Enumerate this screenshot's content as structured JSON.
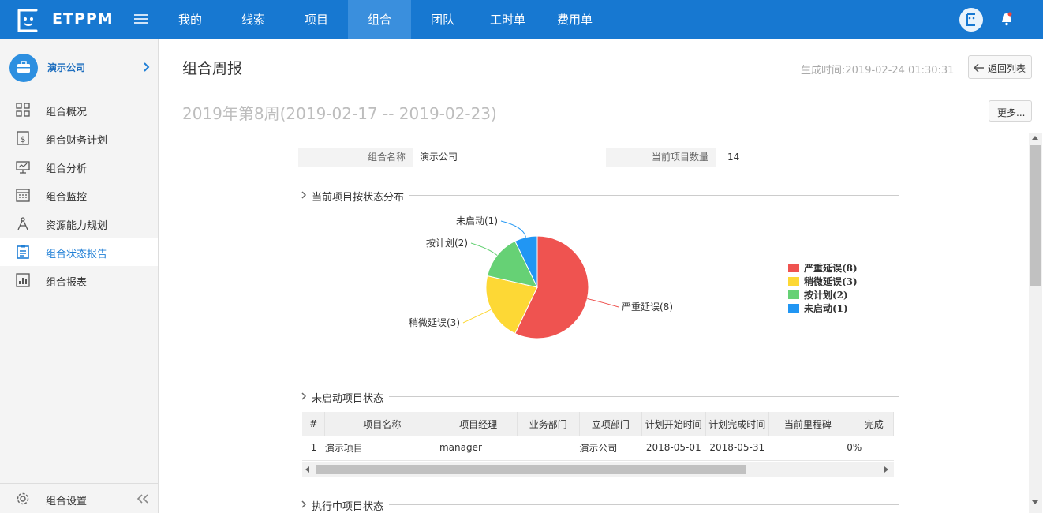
{
  "app": {
    "logo_text": "ETPPM"
  },
  "nav": {
    "items": [
      {
        "label": "我的"
      },
      {
        "label": "线索"
      },
      {
        "label": "项目"
      },
      {
        "label": "组合"
      },
      {
        "label": "团队"
      },
      {
        "label": "工时单"
      },
      {
        "label": "费用单"
      }
    ],
    "active": "组合"
  },
  "sidebar": {
    "company": "演示公司",
    "items": [
      {
        "label": "组合概况",
        "icon": "grid-icon"
      },
      {
        "label": "组合财务计划",
        "icon": "dollar-doc-icon"
      },
      {
        "label": "组合分析",
        "icon": "presentation-icon"
      },
      {
        "label": "组合监控",
        "icon": "calendar-icon"
      },
      {
        "label": "资源能力规划",
        "icon": "compass-icon"
      },
      {
        "label": "组合状态报告",
        "icon": "clipboard-icon"
      },
      {
        "label": "组合报表",
        "icon": "bar-chart-icon"
      }
    ],
    "active": "组合状态报告",
    "settings_label": "组合设置"
  },
  "main": {
    "title": "组合周报",
    "generated_time": "生成时间:2019-02-24 01:30:31",
    "back_button": "返回列表",
    "more_button": "更多...",
    "week": "2019年第8周(2019-02-17 -- 2019-02-23)",
    "info": {
      "name_label": "组合名称",
      "name_value": "演示公司",
      "count_label": "当前项目数量",
      "count_value": "14"
    },
    "sections": {
      "status_distribution": "当前项目按状态分布",
      "not_started": "未启动项目状态",
      "in_progress": "执行中项目状态"
    }
  },
  "chart_data": {
    "type": "pie",
    "categories": [
      "严重延误",
      "稍微延误",
      "按计划",
      "未启动"
    ],
    "values": [
      8,
      3,
      2,
      1
    ],
    "slice_labels": [
      "严重延误(8)",
      "稍微延误(3)",
      "按计划(2)",
      "未启动(1)"
    ],
    "legend": [
      "严重延误(8)",
      "稍微延误(3)",
      "按计划(2)",
      "未启动(1)"
    ],
    "legend_position": "right",
    "colors": [
      "#ef5350",
      "#fdd835",
      "#66d175",
      "#2196f3"
    ]
  },
  "table": {
    "columns": [
      "#",
      "项目名称",
      "项目经理",
      "业务部门",
      "立项部门",
      "计划开始时间",
      "计划完成时间",
      "当前里程碑",
      "完成"
    ],
    "rows": [
      [
        "1",
        "演示项目",
        "manager",
        "",
        "演示公司",
        "2018-05-01",
        "2018-05-31",
        "",
        "0%"
      ]
    ]
  }
}
